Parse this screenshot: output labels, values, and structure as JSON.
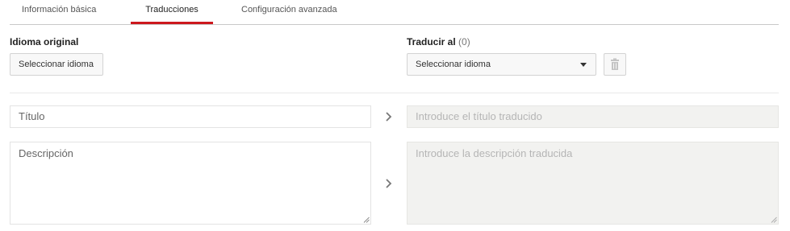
{
  "tabs": [
    {
      "label": "Información básica",
      "active": false
    },
    {
      "label": "Traducciones",
      "active": true
    },
    {
      "label": "Configuración avanzada",
      "active": false
    }
  ],
  "original": {
    "heading": "Idioma original",
    "select_label": "Seleccionar idioma"
  },
  "target": {
    "heading": "Traducir al",
    "count": "(0)",
    "select_label": "Seleccionar idioma"
  },
  "fields": {
    "title_placeholder": "Título",
    "title_translated_placeholder": "Introduce el título traducido",
    "description_placeholder": "Descripción",
    "description_translated_placeholder": "Introduce la descripción traducida"
  },
  "icons": {
    "delete": "trash-icon",
    "arrow": "chevron-right-icon",
    "dropdown": "caret-down-icon",
    "resize": "resize-handle-icon"
  },
  "colors": {
    "active_tab_underline": "#cc181e",
    "disabled_field_bg": "#f2f2f0"
  }
}
